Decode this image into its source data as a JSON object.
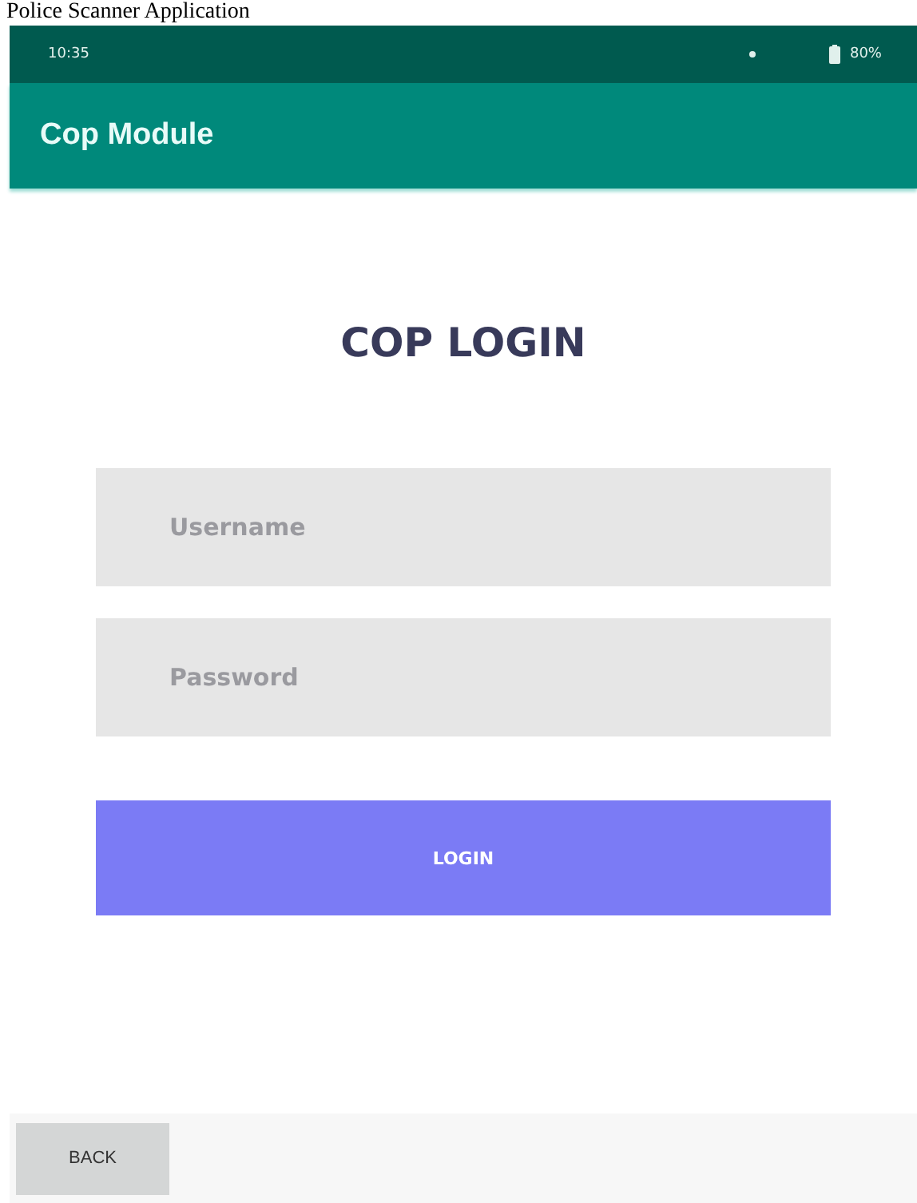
{
  "caption": "Police Scanner Application",
  "status_bar": {
    "time": "10:35",
    "battery": "80%"
  },
  "app_bar": {
    "title": "Cop Module"
  },
  "login": {
    "heading": "COP LOGIN",
    "fields": [
      {
        "placeholder": "Username"
      },
      {
        "placeholder": "Password"
      }
    ],
    "button": "LOGIN"
  },
  "bottom_bar": {
    "back_button": "BACK"
  }
}
